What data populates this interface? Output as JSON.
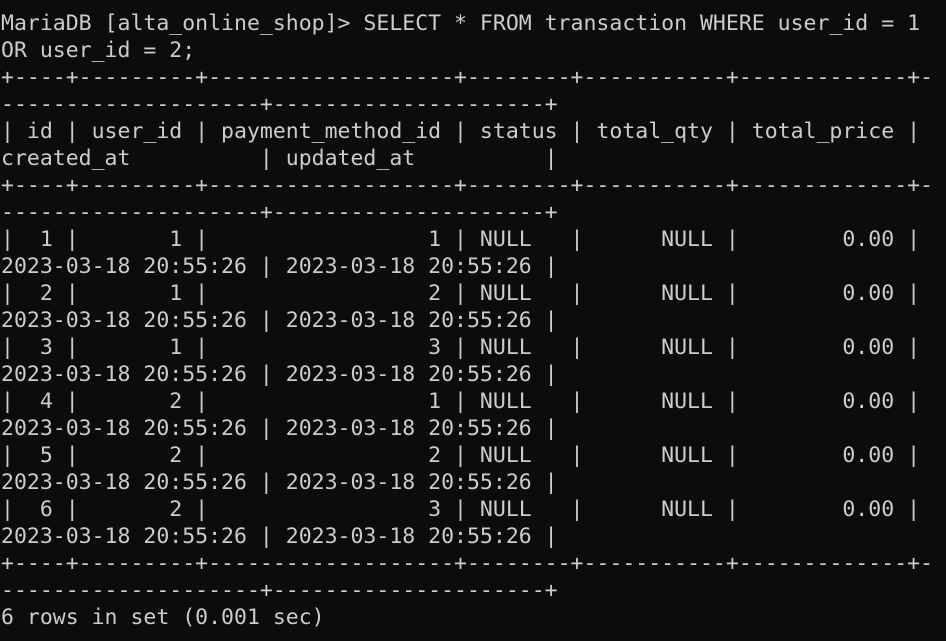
{
  "terminal": {
    "background": "#0c0c0c",
    "foreground": "#cccccc",
    "lines": [
      "MariaDB [alta_online_shop]> SELECT * FROM transaction WHERE user_id = 1",
      "OR user_id = 2;",
      "+----+---------+-------------------+--------+-----------+-------------+-",
      "--------------------+---------------------+",
      "| id | user_id | payment_method_id | status | total_qty | total_price |",
      "created_at          | updated_at          |",
      "+----+---------+-------------------+--------+-----------+-------------+-",
      "--------------------+---------------------+",
      "|  1 |       1 |                 1 | NULL   |      NULL |        0.00 |",
      "2023-03-18 20:55:26 | 2023-03-18 20:55:26 |",
      "|  2 |       1 |                 2 | NULL   |      NULL |        0.00 |",
      "2023-03-18 20:55:26 | 2023-03-18 20:55:26 |",
      "|  3 |       1 |                 3 | NULL   |      NULL |        0.00 |",
      "2023-03-18 20:55:26 | 2023-03-18 20:55:26 |",
      "|  4 |       2 |                 1 | NULL   |      NULL |        0.00 |",
      "2023-03-18 20:55:26 | 2023-03-18 20:55:26 |",
      "|  5 |       2 |                 2 | NULL   |      NULL |        0.00 |",
      "2023-03-18 20:55:26 | 2023-03-18 20:55:26 |",
      "|  6 |       2 |                 3 | NULL   |      NULL |        0.00 |",
      "2023-03-18 20:55:26 | 2023-03-18 20:55:26 |",
      "+----+---------+-------------------+--------+-----------+-------------+-",
      "--------------------+---------------------+",
      "6 rows in set (0.001 sec)"
    ]
  }
}
